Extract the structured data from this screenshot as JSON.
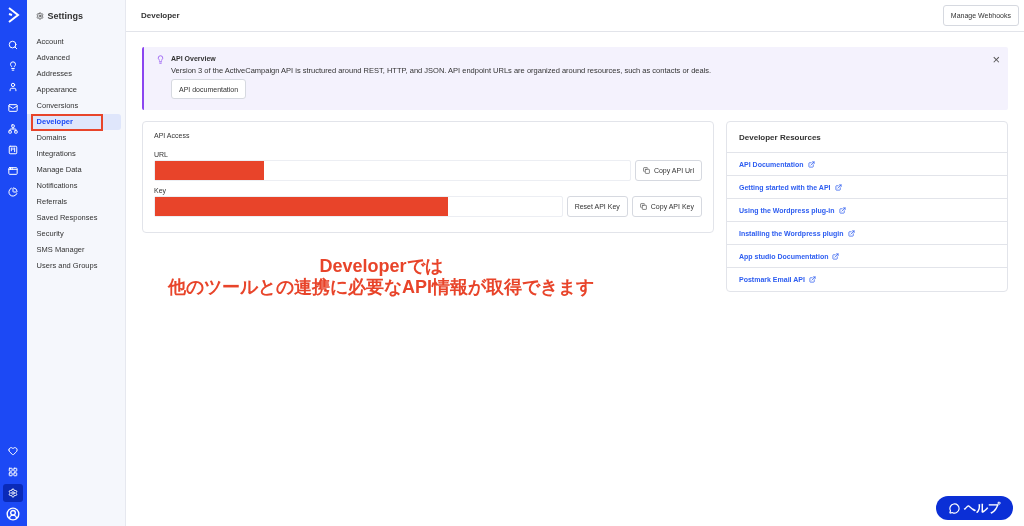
{
  "rail": {
    "top_items": [
      {
        "selected": false
      },
      {
        "selected": false
      },
      {
        "selected": false
      },
      {
        "selected": false
      },
      {
        "selected": false
      },
      {
        "selected": false
      },
      {
        "selected": false
      },
      {
        "selected": false
      }
    ],
    "bottom_items": [
      {
        "selected": false
      },
      {
        "selected": false
      },
      {
        "selected": true
      },
      {
        "selected": false
      }
    ]
  },
  "settings": {
    "title": "Settings",
    "items": [
      {
        "label": "Account",
        "selected": false,
        "highlighted": false
      },
      {
        "label": "Advanced",
        "selected": false,
        "highlighted": false
      },
      {
        "label": "Addresses",
        "selected": false,
        "highlighted": false
      },
      {
        "label": "Appearance",
        "selected": false,
        "highlighted": false
      },
      {
        "label": "Conversions",
        "selected": false,
        "highlighted": false
      },
      {
        "label": "Developer",
        "selected": true,
        "highlighted": true
      },
      {
        "label": "Domains",
        "selected": false,
        "highlighted": false
      },
      {
        "label": "Integrations",
        "selected": false,
        "highlighted": false
      },
      {
        "label": "Manage Data",
        "selected": false,
        "highlighted": false
      },
      {
        "label": "Notifications",
        "selected": false,
        "highlighted": false
      },
      {
        "label": "Referrals",
        "selected": false,
        "highlighted": false
      },
      {
        "label": "Saved Responses",
        "selected": false,
        "highlighted": false
      },
      {
        "label": "Security",
        "selected": false,
        "highlighted": false
      },
      {
        "label": "SMS Manager",
        "selected": false,
        "highlighted": false
      },
      {
        "label": "Users and Groups",
        "selected": false,
        "highlighted": false
      }
    ]
  },
  "header": {
    "title": "Developer",
    "button": "Manage Webhooks"
  },
  "overview": {
    "title": "API Overview",
    "text": "Version 3 of the ActiveCampaign API is structured around REST, HTTP, and JSON. API endpoint URLs are organized around resources, such as contacts or deals.",
    "button": "API documentation",
    "close": "×"
  },
  "api_access": {
    "title": "API Access",
    "fields": [
      {
        "label": "URL",
        "level": 0.23,
        "buttons": [
          "Copy API Url"
        ]
      },
      {
        "label": "Key",
        "level": 0.72,
        "buttons": [
          "Reset API Key",
          "Copy API Key"
        ]
      }
    ]
  },
  "resources": {
    "title": "Developer Resources",
    "links": [
      "API Documentation",
      "Getting started with the API",
      "Using the Wordpress plug-in",
      "Installing the Wordpress plugin",
      "App studio Documentation",
      "Postmark Email API"
    ]
  },
  "annotation": {
    "lines": [
      "Developerでは",
      "他のツールとの連携に必要なAPI情報が取得できます"
    ]
  },
  "help_button": "ヘルプ"
}
